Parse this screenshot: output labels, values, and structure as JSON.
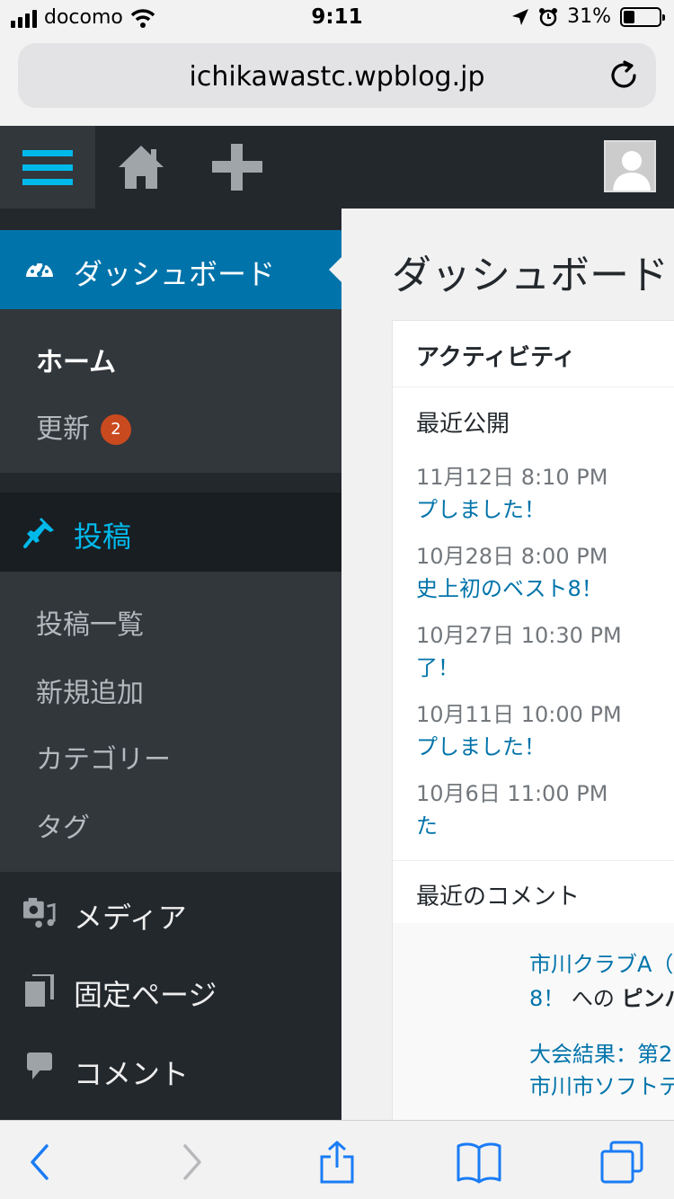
{
  "status_bar": {
    "carrier": "docomo",
    "time": "9:11",
    "battery": "31%",
    "battery_level": 0.31
  },
  "browser": {
    "url": "ichikawastc.wpblog.jp"
  },
  "sidebar": {
    "dashboard": "ダッシュボード",
    "dashboard_sub": {
      "home": "ホーム",
      "updates": "更新",
      "updates_count": "2"
    },
    "posts": "投稿",
    "posts_sub": {
      "all": "投稿一覧",
      "new": "新規追加",
      "categories": "カテゴリー",
      "tags": "タグ"
    },
    "media": "メディア",
    "pages": "固定ページ",
    "comments": "コメント"
  },
  "main": {
    "title": "ダッシュボード",
    "activity": {
      "heading": "アクティビティ",
      "recent_published": "最近公開",
      "items": [
        {
          "date": "11月12日 8:10 PM",
          "title": "プしました！"
        },
        {
          "date": "10月28日 8:00 PM",
          "title": "史上初のベスト8！"
        },
        {
          "date": "10月27日 10:30 PM",
          "title": "了！"
        },
        {
          "date": "10月11日 10:00 PM",
          "title": "プしました！"
        },
        {
          "date": "10月6日 11:00 PM",
          "title": "た"
        }
      ],
      "recent_comments": "最近のコメント",
      "comments": [
        {
          "line1": "市川クラブA（",
          "line2_link": "8！",
          "line2_text": " への ",
          "line2_author": "ピンバ"
        },
        {
          "line1": "大会結果：第2",
          "line2_link": "市川市ソフトテ"
        }
      ]
    }
  }
}
